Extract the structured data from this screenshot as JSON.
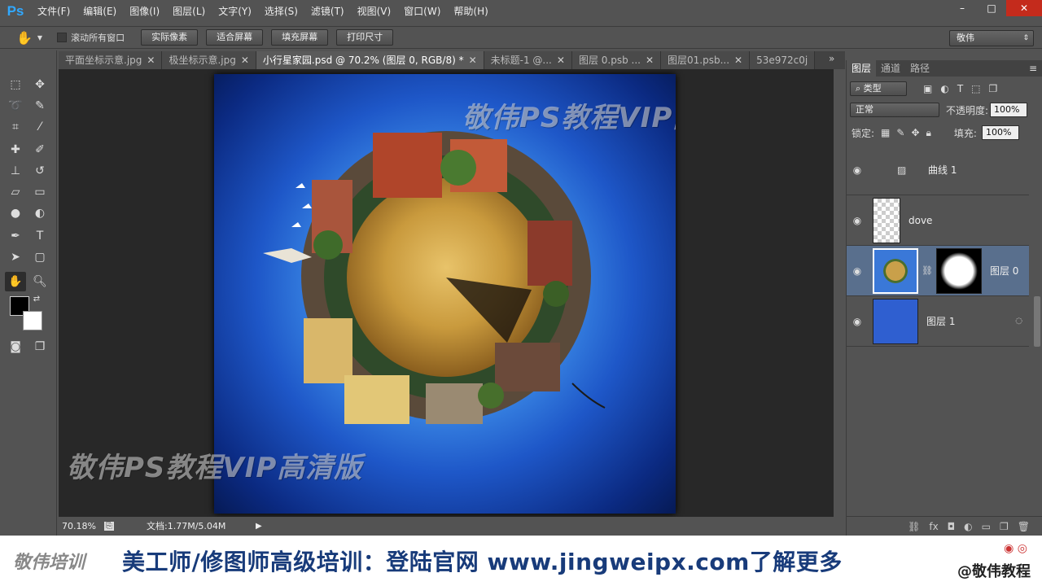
{
  "app": {
    "logo": "Ps"
  },
  "menu": [
    "文件(F)",
    "编辑(E)",
    "图像(I)",
    "图层(L)",
    "文字(Y)",
    "选择(S)",
    "滤镜(T)",
    "视图(V)",
    "窗口(W)",
    "帮助(H)"
  ],
  "window_controls": {
    "minimize": "–",
    "maximize": "□",
    "close": "✕"
  },
  "options_bar": {
    "scroll_all_label": "滚动所有窗口",
    "scroll_all_checked": false,
    "buttons": [
      "实际像素",
      "适合屏幕",
      "填充屏幕",
      "打印尺寸"
    ],
    "workspace": "敬伟"
  },
  "tabs": [
    {
      "label": "平面坐标示意.jpg",
      "active": false
    },
    {
      "label": "极坐标示意.jpg",
      "active": false
    },
    {
      "label": "小行星家园.psd @ 70.2% (图层 0, RGB/8) *",
      "active": true
    },
    {
      "label": "未标题-1 @...",
      "active": false
    },
    {
      "label": "图层 0.psb ...",
      "active": false
    },
    {
      "label": "图层01.psb...",
      "active": false
    },
    {
      "label": "53e972c0j",
      "active": false
    }
  ],
  "canvas": {
    "watermark_top": "敬伟PS教程VIP高清版",
    "watermark_bottom": "敬伟PS教程VIP高清版"
  },
  "status": {
    "zoom": "70.18%",
    "doc_info": "文档:1.77M/5.04M"
  },
  "layers_panel": {
    "tabs": [
      "图层",
      "通道",
      "路径"
    ],
    "filter_kind": "类型",
    "blend_mode": "正常",
    "opacity_label": "不透明度:",
    "opacity_value": "100%",
    "lock_label": "锁定:",
    "fill_label": "填充:",
    "fill_value": "100%",
    "layers": [
      {
        "name": "曲线 1",
        "type": "adjustment",
        "selected": false
      },
      {
        "name": "dove",
        "type": "smart",
        "selected": false
      },
      {
        "name": "图层 0",
        "type": "smart-mask",
        "selected": true
      },
      {
        "name": "图层 1",
        "type": "smart",
        "selected": false
      }
    ]
  },
  "banner": {
    "logo": "敬伟培训",
    "text": "美工师/修图师高级培训：登陆官网 www.jingweipx.com了解更多",
    "handle": "@敬伟教程"
  },
  "colors": {
    "accent": "#31a8ff",
    "selected_layer": "#596f8d",
    "banner_text": "#183b7a"
  }
}
